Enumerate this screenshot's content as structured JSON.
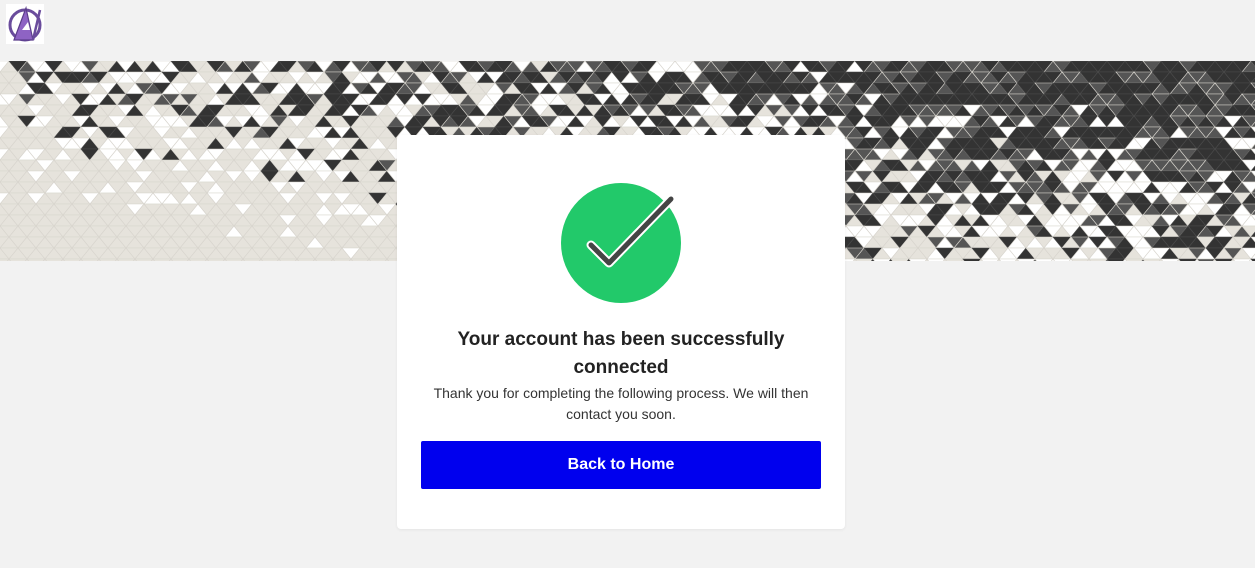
{
  "header": {
    "logo_icon": "avengers-logo-icon"
  },
  "banner": {
    "pattern": "geometric-triangle-mosaic",
    "colors": {
      "light": "#e6e3dc",
      "dark": "#333333",
      "mid": "#555555"
    }
  },
  "card": {
    "status_icon": "check-circle-icon",
    "status_color": "#22c96a",
    "title": "Your account has been successfully connected",
    "message": "Thank you for completing the following process. We will then contact you soon.",
    "button_label": "Back to Home",
    "button_color": "#0000ee"
  }
}
